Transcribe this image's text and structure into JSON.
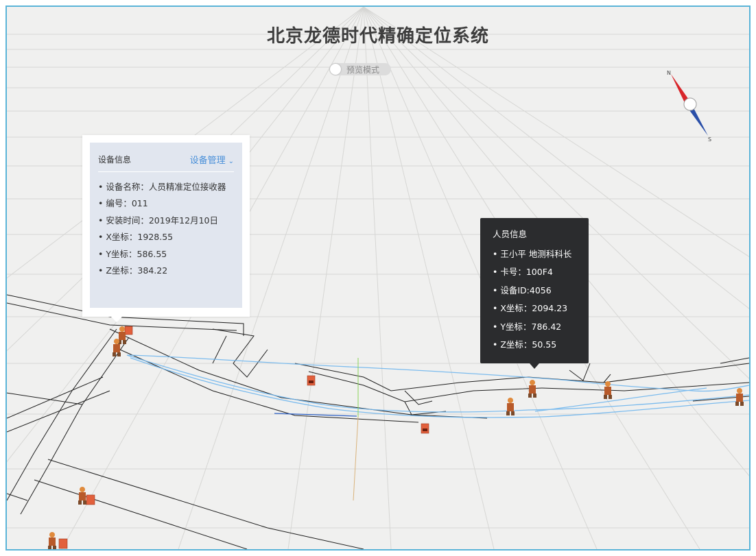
{
  "app": {
    "title": "北京龙德时代精确定位系统",
    "mode_label": "预览模式"
  },
  "compass": {
    "north": "N",
    "south": "S"
  },
  "device_panel": {
    "title": "设备信息",
    "manage_label": "设备管理",
    "manage_icon": "chevron-down-icon",
    "fields": [
      "设备名称：人员精准定位接收器",
      "编号：011",
      "安装时间：2019年12月10日",
      "X坐标：1928.55",
      "Y坐标：586.55",
      "Z坐标：384.22"
    ]
  },
  "person_panel": {
    "title": "人员信息",
    "fields": [
      "王小平 地测科科长",
      "卡号：100F4",
      "设备ID:4056",
      "X坐标：2094.23",
      "Y坐标：786.42",
      "Z坐标：50.55"
    ]
  },
  "colors": {
    "frame_border": "#5ab4d8",
    "track": "#6fb6ee",
    "worker": "#c8532e",
    "device": "#e2603c",
    "panel_dark": "#2b2c2e",
    "panel_light": "#e1e6ef",
    "accent": "#4a90d9"
  }
}
